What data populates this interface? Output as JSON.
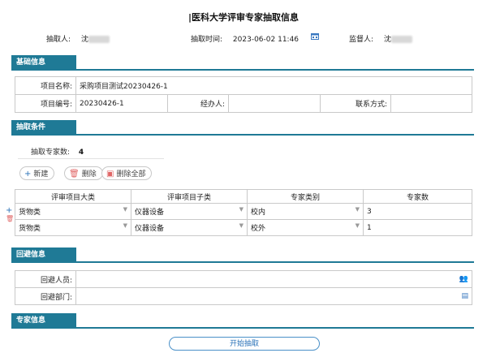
{
  "title": "|医科大学评审专家抽取信息",
  "header": {
    "extractor_label": "抽取人:",
    "extractor_value": "沈",
    "time_label": "抽取时间:",
    "time_value": "2023-06-02 11:46",
    "supervisor_label": "监督人:",
    "supervisor_value": "沈"
  },
  "sections": {
    "basic": "基础信息",
    "conditions": "抽取条件",
    "avoid": "回避信息",
    "experts": "专家信息"
  },
  "basic": {
    "project_name_label": "项目名称:",
    "project_name_value": "采购项目测试20230426-1",
    "project_no_label": "项目编号:",
    "project_no_value": "20230426-1",
    "handler_label": "经办人:",
    "handler_value": "",
    "contact_label": "联系方式:",
    "contact_value": ""
  },
  "conditions": {
    "count_label": "抽取专家数:",
    "count_value": "4",
    "add_label": "新建",
    "delete_label": "删除",
    "delete_all_label": "删除全部",
    "columns": [
      "评审项目大类",
      "评审项目子类",
      "专家类别",
      "专家数"
    ],
    "rows": [
      {
        "major": "货物类",
        "minor": "仪器设备",
        "category": "校内",
        "count": "3"
      },
      {
        "major": "货物类",
        "minor": "仪器设备",
        "category": "校外",
        "count": "1"
      }
    ]
  },
  "avoid": {
    "persons_label": "回避人员:",
    "dept_label": "回避部门:"
  },
  "actions": {
    "start_label": "开始抽取"
  },
  "colors": {
    "accent": "#1f7a96",
    "button_blue": "#2a72b8"
  }
}
